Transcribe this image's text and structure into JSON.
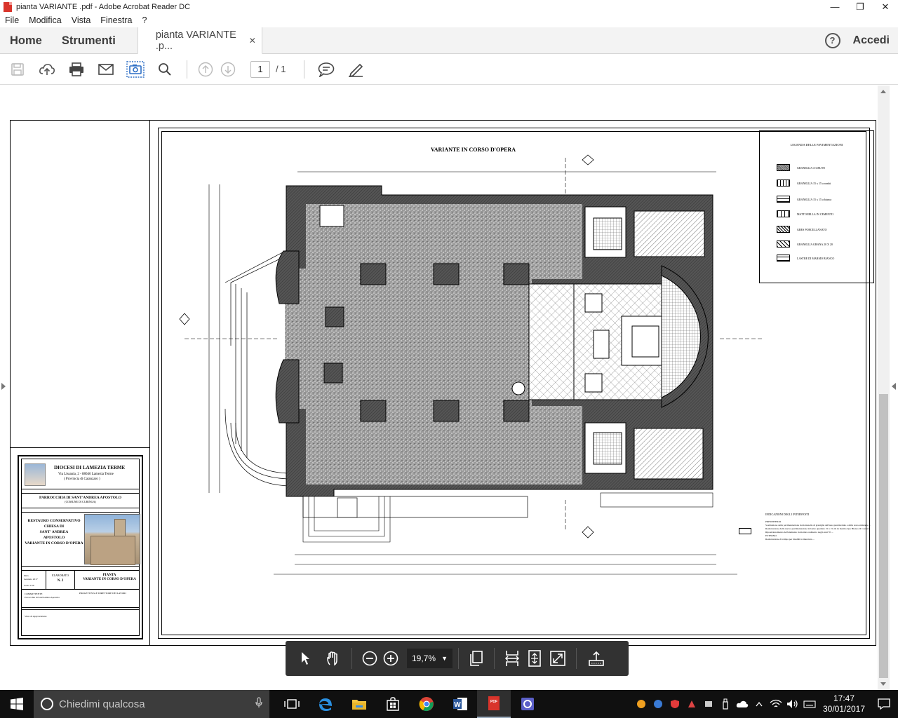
{
  "window": {
    "title": "pianta VARIANTE .pdf - Adobe Acrobat Reader DC",
    "minimize": "—",
    "maximize": "❐",
    "close": "✕"
  },
  "menu": [
    "File",
    "Modifica",
    "Vista",
    "Finestra",
    "?"
  ],
  "tabs": {
    "home": "Home",
    "tools": "Strumenti",
    "document": "pianta VARIANTE .p...",
    "close": "✕",
    "signin": "Accedi"
  },
  "toolbar": {
    "page_current": "1",
    "page_total": "/ 1",
    "icons": [
      "save-icon",
      "upload-icon",
      "print-icon",
      "email-icon",
      "snapshot-icon",
      "search-icon",
      "page-up-icon",
      "page-down-icon",
      "comment-icon",
      "sign-icon"
    ]
  },
  "drawing": {
    "title": "VARIANTE IN CORSO D'OPERA",
    "legend_title": "LEGENDA DELLE PAVIMENTAZIONI",
    "legend_items": [
      "GRANIGLIA A GRUTO",
      "GRANIGLIA 15 x 15 a rombi",
      "GRANIGLIA 15 x 15 a bianca",
      "MATTONELLA IN CEMENTO",
      "GRES PORCELLANATO",
      "GRANIGLIA GRANA 20 X 20",
      "LASTRE DI MARMO BIANCO"
    ],
    "notes_title": "INDICAZIONI DEGLI INTERVENTI",
    "notes": [
      "PRESBITERIO",
      "Sostituzione della pavimentazione in mattonelle di graniglia dell'area presbiteriale e della zona antistante ...",
      "Realizzazione della nuova pavimentazione in lastre quadrate 15 x 15 cm in marmo tipo Bianco di Carrara",
      "Riposizionamento dell'elemento in marmo realizzato negli anni 70 ...",
      "ESTERNO",
      "Realizzazione di rampa per disabili in muratura ..."
    ]
  },
  "cartouche": {
    "diocese": "DIOCESI DI LAMEZIA TERME",
    "address": "Via Lissania, 2 - 88046 Lamezia Terme",
    "province": "( Provincia di Catanzaro )",
    "parish": "PARROCCHIA DI SANT'ANDREA APOSTOLO",
    "parish_sub": "(COMUNE DI CURINGA)",
    "project_lines": [
      "RESTAURO CONSERVATIVO",
      "CHIESA DI",
      "SANT' ANDREA",
      "APOSTOLO",
      "VARIANTE IN CORSO D'OPERA"
    ],
    "date_label": "Data",
    "date_value": "Gennaio 2017",
    "scale": "Scala 1:50",
    "board_label": "ELABORATO",
    "board_number": "N. 2",
    "board_title": "PIANTA",
    "board_subtitle": "VARIANTE IN CORSO D'OPERA",
    "client_label": "COMMITTENTE",
    "client_value": "Parrocchia di Sant'Andrea Apostolo",
    "designer_label": "PROGETTISTA E DIRETTORE DEI LAVORI",
    "visa": "Visto di Approvazione"
  },
  "floating_toolbar": {
    "zoom": "19,7%"
  },
  "taskbar": {
    "search_placeholder": "Chiedimi qualcosa",
    "time": "17:47",
    "date": "30/01/2017"
  }
}
